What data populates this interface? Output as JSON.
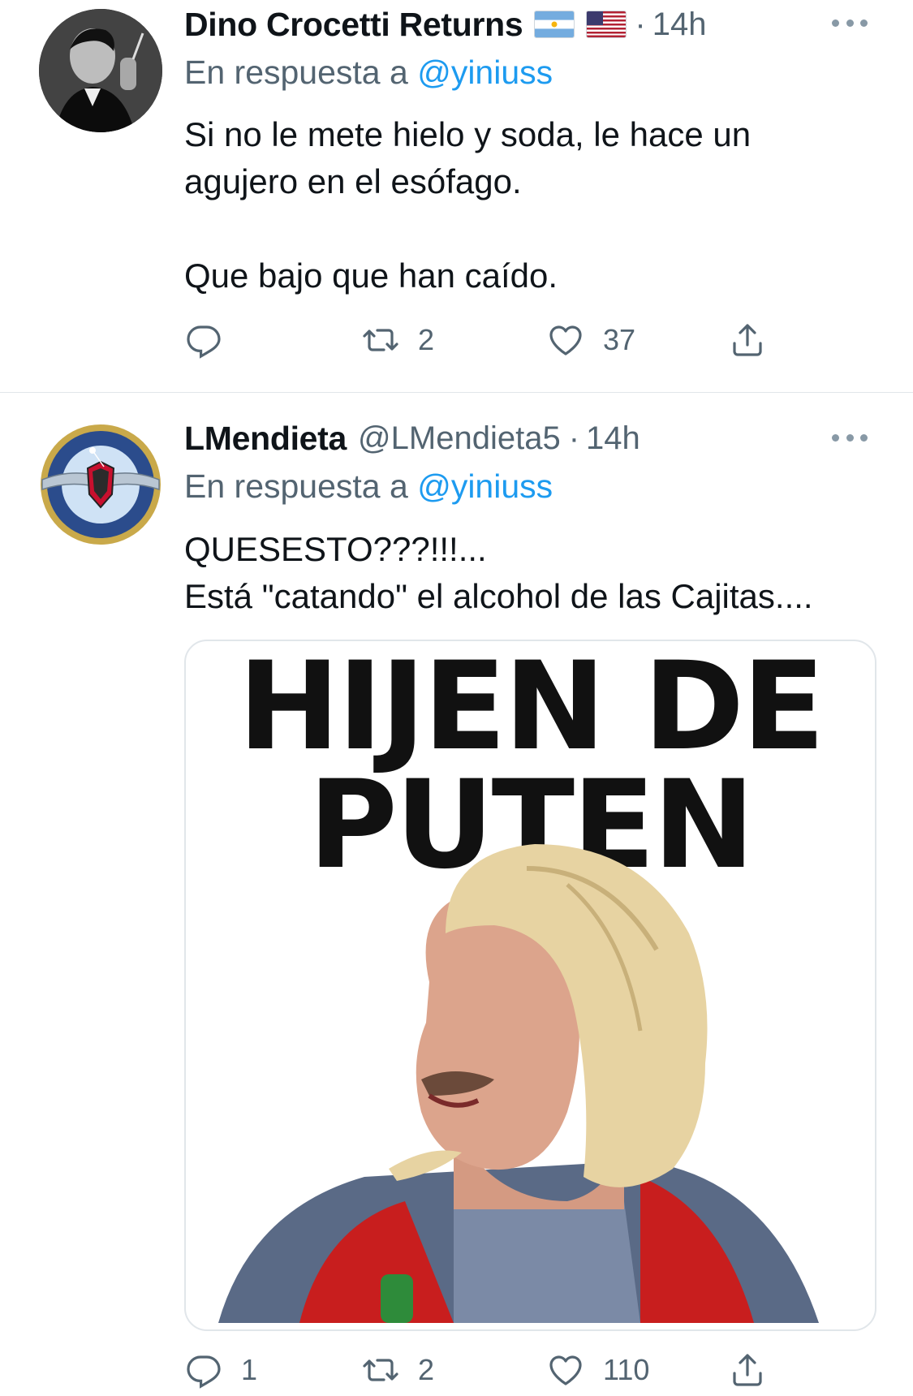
{
  "tweets": [
    {
      "display_name": "Dino Crocetti Returns",
      "flags": [
        "argentina-flag",
        "usa-flag"
      ],
      "time": "14h",
      "reply_prefix": "En respuesta a",
      "reply_mention": "@yiniuss",
      "text_lines": [
        "Si no le mete hielo y soda, le hace un",
        "agujero en el esófago.",
        "",
        "Que bajo que han caído."
      ],
      "counts": {
        "replies": "",
        "retweets": "2",
        "likes": "37"
      }
    },
    {
      "display_name": "LMendieta",
      "handle": "@LMendieta5",
      "time": "14h",
      "reply_prefix": "En respuesta a",
      "reply_mention": "@yiniuss",
      "text_lines": [
        "QUESESTO???!!!...",
        "Está \"catando\" el alcohol de las Cajitas...."
      ],
      "media": {
        "caption_line1": "HIJEN DE",
        "caption_line2": "PUTEN"
      },
      "counts": {
        "replies": "1",
        "retweets": "2",
        "likes": "110"
      }
    }
  ],
  "colors": {
    "secondary_text": "#536471",
    "link": "#1d9bf0",
    "divider": "#e1e6ea"
  },
  "icons": [
    "reply-icon",
    "retweet-icon",
    "like-icon",
    "share-icon",
    "more-icon"
  ]
}
